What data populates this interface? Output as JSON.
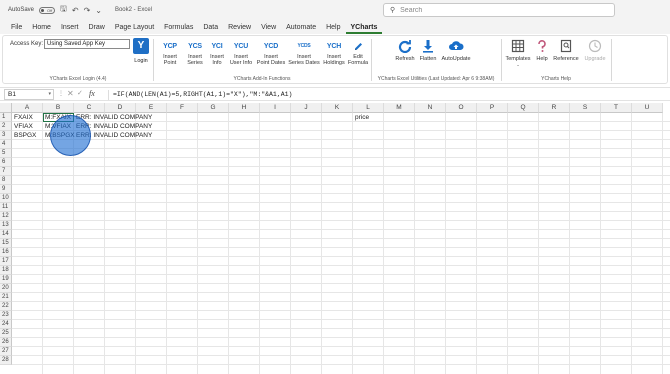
{
  "titlebar": {
    "autosave_label": "AutoSave",
    "toggle_state": "Off",
    "title": "Book2 - Excel",
    "search_placeholder": "Search"
  },
  "menu": {
    "items": [
      "File",
      "Home",
      "Insert",
      "Draw",
      "Page Layout",
      "Formulas",
      "Data",
      "Review",
      "View",
      "Automate",
      "Help",
      "YCharts"
    ],
    "active": "YCharts"
  },
  "ribbon": {
    "login_group": {
      "access_key_label": "Access Key:",
      "access_key_value": "Using Saved App Key",
      "login_label": "Login",
      "group_label": "YCharts Excel Login (4.4)"
    },
    "addin_group": {
      "buttons": [
        {
          "icon_text": "YCP",
          "label_1": "Insert",
          "label_2": "Point"
        },
        {
          "icon_text": "YCS",
          "label_1": "Insert",
          "label_2": "Series"
        },
        {
          "icon_text": "YCI",
          "label_1": "Insert",
          "label_2": "Info"
        },
        {
          "icon_text": "YCU",
          "label_1": "Insert",
          "label_2": "User Info"
        },
        {
          "icon_text": "YCD",
          "label_1": "Insert",
          "label_2": "Point Dates"
        },
        {
          "icon_text": "YCDS",
          "label_1": "Insert",
          "label_2": "Series Dates"
        },
        {
          "icon_text": "YCH",
          "label_1": "Insert",
          "label_2": "Holdings"
        },
        {
          "icon_text": "",
          "label_1": "Edit",
          "label_2": "Formula"
        }
      ],
      "group_label": "YCharts Add-In Functions"
    },
    "utilities_group": {
      "buttons": [
        {
          "label": "Refresh",
          "icon": "refresh-icon"
        },
        {
          "label": "Flatten",
          "icon": "download-arrow-icon"
        },
        {
          "label": "AutoUpdate",
          "icon": "cloud-upload-icon"
        }
      ],
      "group_label": "YCharts Excel Utilities (Last Updated: Apr 6 9:38AM)"
    },
    "help_group": {
      "buttons": [
        {
          "label": "Templates",
          "icon": "table-icon"
        },
        {
          "label": "Help",
          "icon": "question-icon"
        },
        {
          "label": "Reference",
          "icon": "book-icon"
        },
        {
          "label": "Upgrade",
          "icon": "clock-icon"
        }
      ],
      "group_label": "YCharts Help"
    }
  },
  "formula_bar": {
    "name_box": "B1",
    "fx": "fx",
    "formula": "=IF(AND(LEN(A1)=5,RIGHT(A1,1)=\"X\"),\"M:\"&A1,A1)"
  },
  "sheet": {
    "columns": [
      "A",
      "B",
      "C",
      "D",
      "E",
      "F",
      "G",
      "H",
      "I",
      "J",
      "K",
      "L",
      "M",
      "N",
      "O",
      "P",
      "Q",
      "R",
      "S",
      "T",
      "U"
    ],
    "rows": [
      "1",
      "2",
      "3",
      "4",
      "5",
      "6",
      "7",
      "8",
      "9",
      "10",
      "11",
      "12",
      "13",
      "14",
      "15",
      "16",
      "17",
      "18",
      "19",
      "20",
      "21",
      "22",
      "23",
      "24",
      "25",
      "26",
      "27",
      "28"
    ],
    "cells": {
      "A1": "FXAIX",
      "B1": "M:FXAIX",
      "C1": "ERR: INVALID COMPANY",
      "A2": "VFIAX",
      "B2": "M:VFIAX",
      "C2": "ERR: INVALID COMPANY",
      "A3": "BSPGX",
      "B3": "M:BSPGX",
      "C3": "ERR: INVALID COMPANY",
      "L1": "price"
    }
  },
  "colors": {
    "accent_green": "#217346",
    "ycharts_blue": "#1a6fc9",
    "cursor_highlight": "#1e6ed2"
  }
}
